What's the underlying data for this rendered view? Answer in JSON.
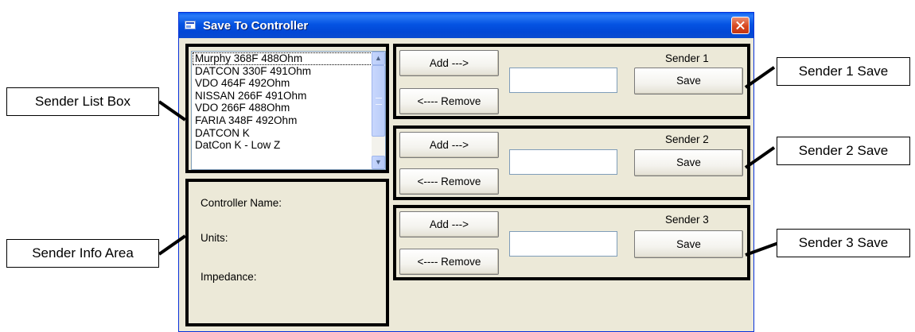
{
  "window": {
    "title": "Save To Controller"
  },
  "sender_list": {
    "items": [
      "Murphy 368F 488Ohm",
      "DATCON 330F 491Ohm",
      "VDO 464F 492Ohm",
      "NISSAN 266F 491Ohm",
      "VDO 266F 488Ohm",
      "FARIA 348F 492Ohm",
      "DATCON K",
      "DatCon K - Low Z"
    ],
    "selected_index": 0
  },
  "info": {
    "controller_name_label": "Controller Name:",
    "units_label": "Units:",
    "impedance_label": "Impedance:"
  },
  "senders": [
    {
      "label": "Sender 1",
      "add_label": "Add --->",
      "remove_label": "<---- Remove",
      "save_label": "Save",
      "value": ""
    },
    {
      "label": "Sender 2",
      "add_label": "Add --->",
      "remove_label": "<---- Remove",
      "save_label": "Save",
      "value": ""
    },
    {
      "label": "Sender 3",
      "add_label": "Add --->",
      "remove_label": "<---- Remove",
      "save_label": "Save",
      "value": ""
    }
  ],
  "callouts": {
    "sender_list_box": "Sender List  Box",
    "sender_info_area": "Sender Info Area",
    "sender_1_save": "Sender 1 Save",
    "sender_2_save": "Sender 2 Save",
    "sender_3_save": "Sender 3 Save"
  }
}
